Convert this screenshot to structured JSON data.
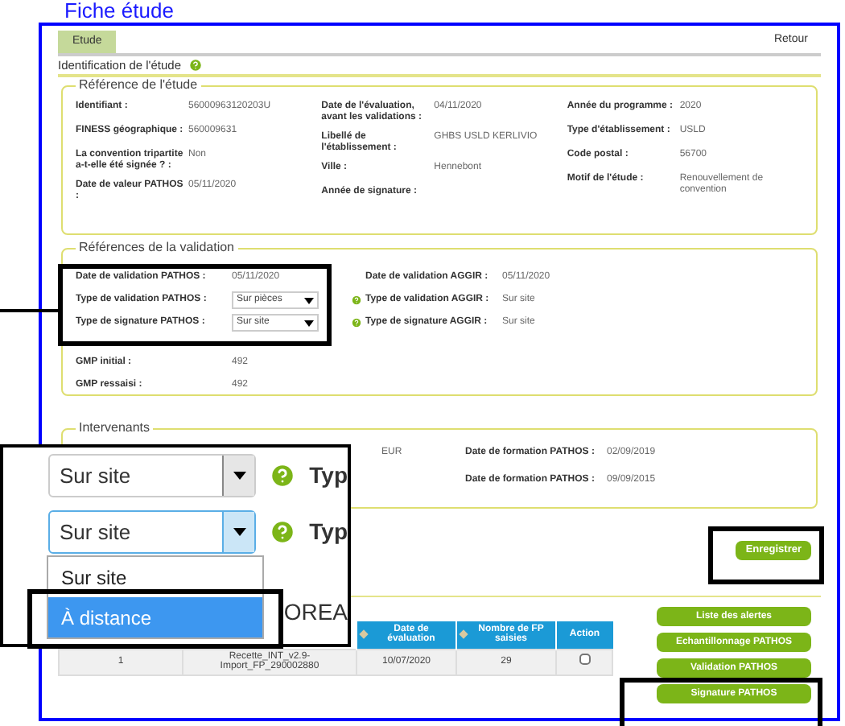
{
  "page_title": "Fiche étude",
  "tabs": [
    {
      "label": "Etude",
      "selected": true
    }
  ],
  "back_link": "Retour",
  "section_title": "Identification de l'étude",
  "reference": {
    "legend": "Référence de l'étude",
    "columns": [
      [
        {
          "label": "Identifiant :",
          "value": "56000963120203U"
        },
        {
          "label": "FINESS géographique :",
          "value": "560009631"
        },
        {
          "label": "La convention tripartite a-t-elle été signée ? :",
          "value": "Non"
        },
        {
          "label": "Date de valeur PATHOS :",
          "value": "05/11/2020"
        }
      ],
      [
        {
          "label": "Date de l'évaluation, avant les validations :",
          "value": "04/11/2020"
        },
        {
          "label": "Libellé de l'établissement :",
          "value": "GHBS USLD KERLIVIO"
        },
        {
          "label": "Ville :",
          "value": "Hennebont"
        },
        {
          "label": "Année de signature :"
        }
      ],
      [
        {
          "label": "Année du programme :",
          "value": "2020"
        },
        {
          "label": "Type d'établissement :",
          "value": "USLD"
        },
        {
          "label": "Code postal :",
          "value": "56700"
        },
        {
          "label": "Motif de l'étude :",
          "value": "Renouvellement de convention"
        }
      ]
    ]
  },
  "validation": {
    "legend": "Références de la validation",
    "left": [
      {
        "label": "Date de validation PATHOS :",
        "value": "05/11/2020",
        "kind": "text"
      },
      {
        "label": "Type de validation PATHOS :",
        "value": "Sur pièces",
        "kind": "select"
      },
      {
        "label": "Type de signature PATHOS :",
        "value": "Sur site",
        "kind": "select"
      },
      {
        "label": "GMP initial :",
        "value": "492",
        "kind": "text"
      },
      {
        "label": "GMP ressaisi :",
        "value": "492",
        "kind": "text"
      }
    ],
    "right": [
      {
        "label": "Date de validation AGGIR :",
        "value": "05/11/2020",
        "help": false
      },
      {
        "label": "Type de validation AGGIR :",
        "value": "Sur site",
        "help": true
      },
      {
        "label": "Type de signature AGGIR :",
        "value": "Sur site",
        "help": true
      }
    ]
  },
  "intervenants": {
    "legend": "Intervenants",
    "fragment": "EUR",
    "rows": [
      {
        "label": "Date de formation PATHOS :",
        "value": "02/09/2019"
      },
      {
        "label": "Date de formation PATHOS :",
        "value": "09/09/2015"
      }
    ]
  },
  "save_button": "Enregistrer",
  "table": {
    "columns": [
      {},
      {},
      {
        "label": "Date de évaluation",
        "sortable": true
      },
      {
        "label": "Nombre de FP saisies",
        "sortable": true
      },
      {
        "label": "Action",
        "sortable": false
      }
    ],
    "rows": [
      {
        "cells": [
          "1",
          "Recette_INT_v2.9-Import_FP_290002880",
          "10/07/2020",
          "29"
        ],
        "checked": false
      }
    ]
  },
  "side_buttons": [
    "Liste des alertes",
    "Echantillonnage PATHOS",
    "Validation PATHOS",
    "Signature PATHOS"
  ],
  "zoom_inset": {
    "selects": [
      {
        "value": "Sur site",
        "label": "Typ",
        "focused": false
      },
      {
        "value": "Sur site",
        "label": "Typ",
        "focused": true
      }
    ],
    "options": [
      {
        "label": "Sur site",
        "selected": false
      },
      {
        "label": "À distance",
        "selected": true
      }
    ],
    "behind_text": "OREA"
  }
}
